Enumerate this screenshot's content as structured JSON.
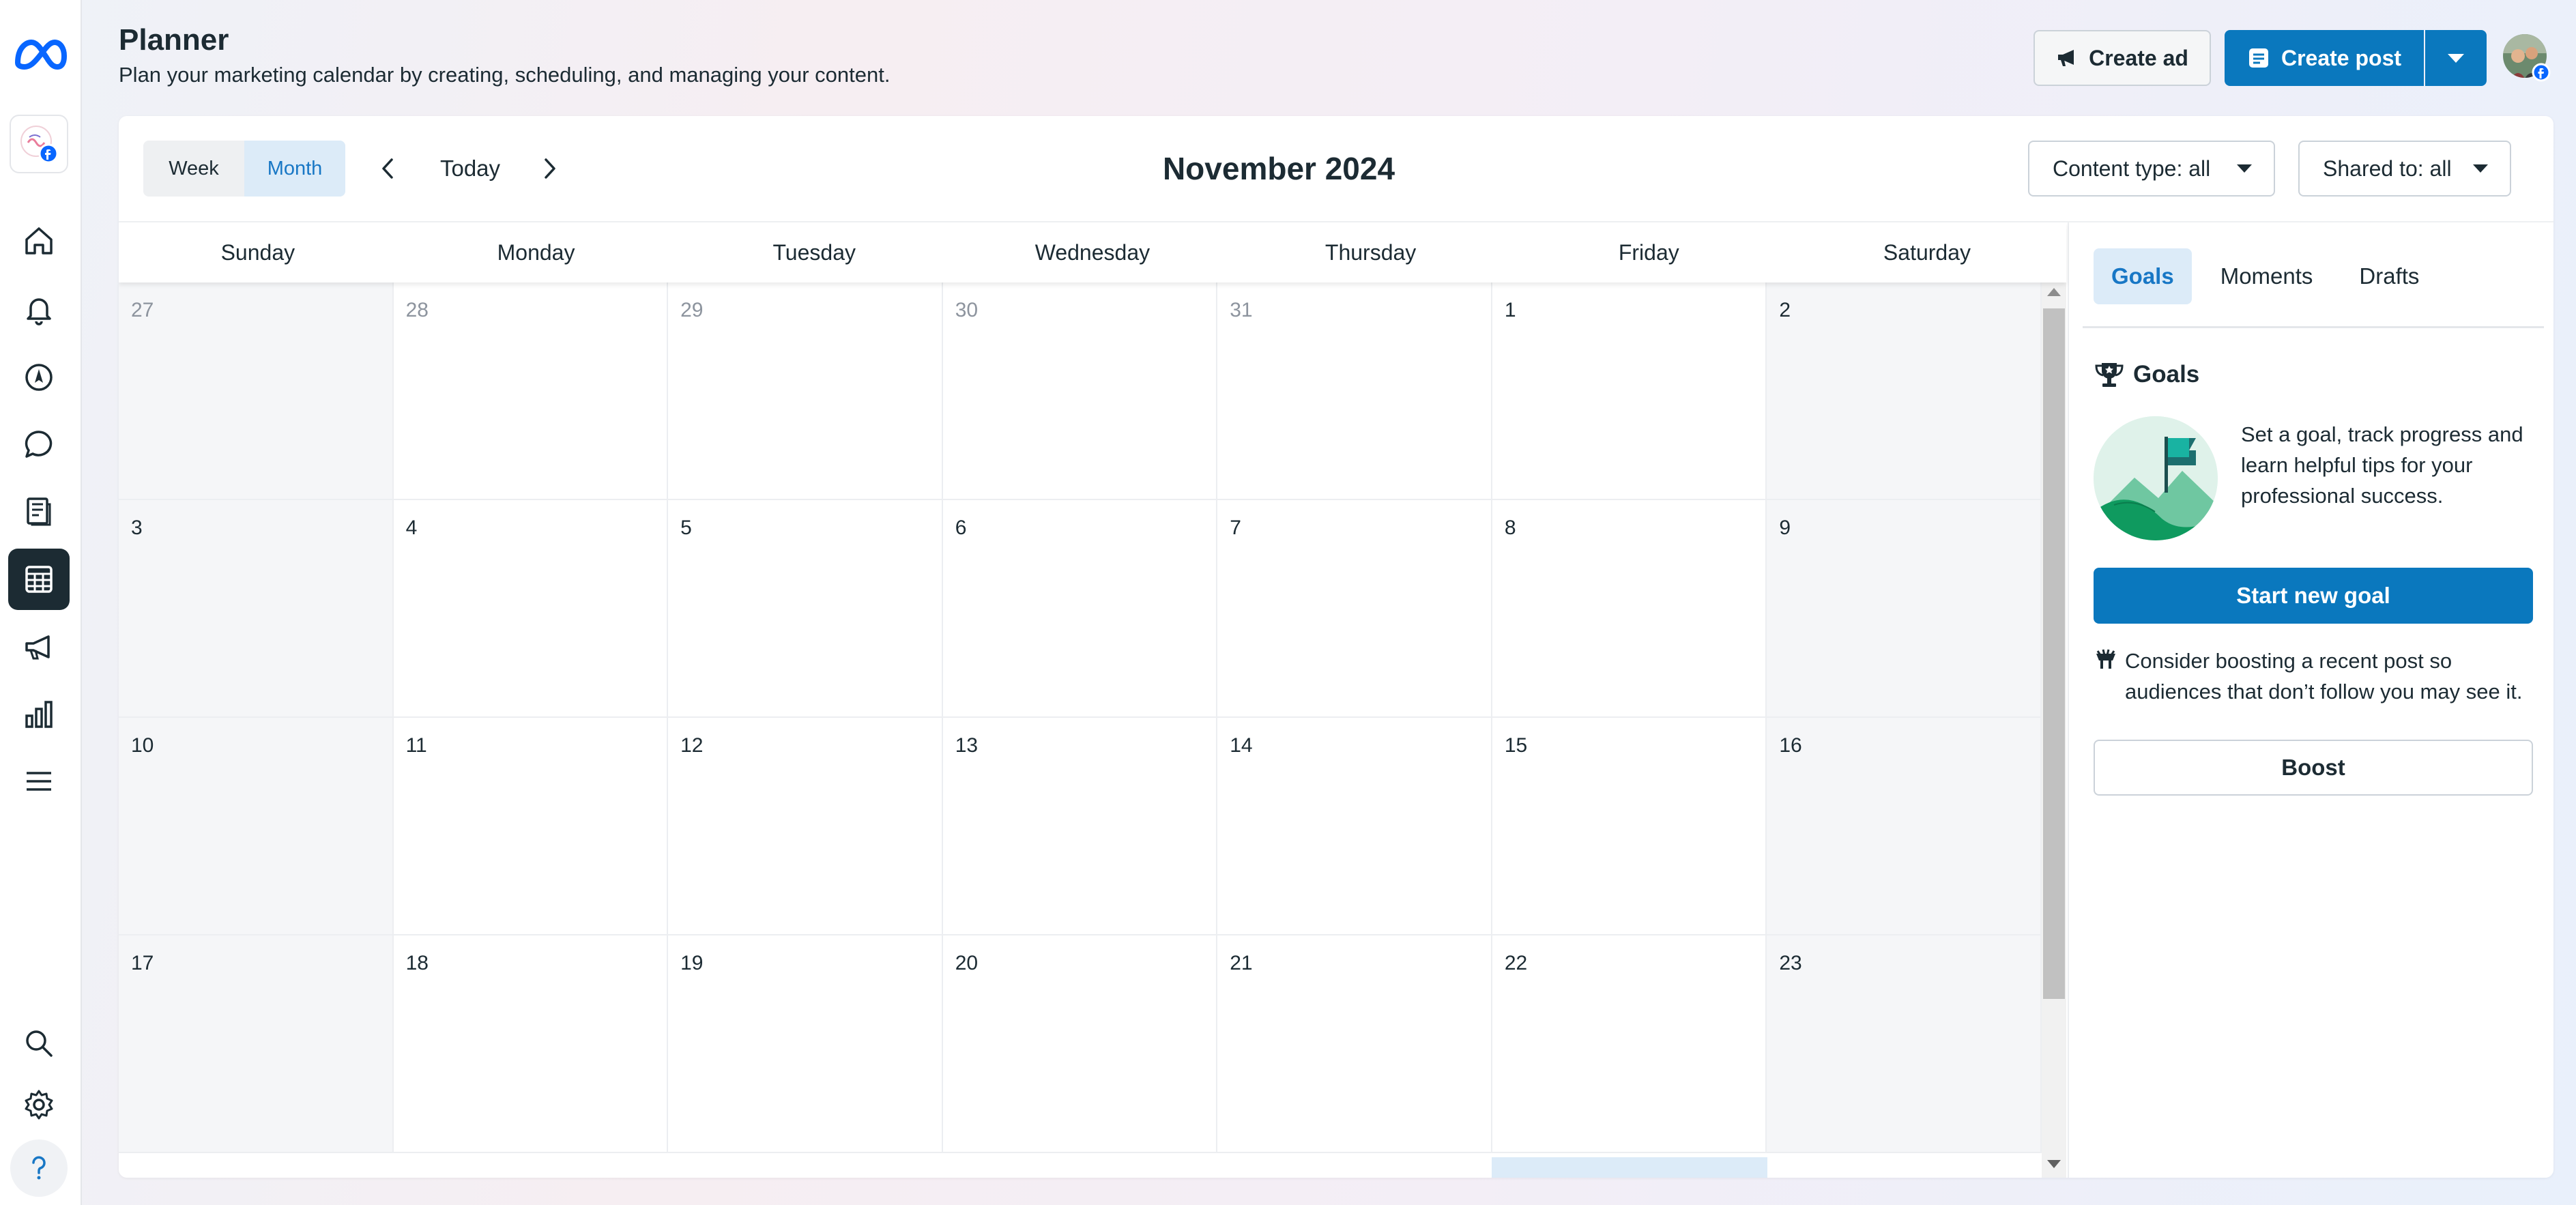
{
  "header": {
    "title": "Planner",
    "subtitle": "Plan your marketing calendar by creating, scheduling, and managing your content.",
    "create_ad_label": "Create ad",
    "create_post_label": "Create post"
  },
  "sidebar": {
    "items": [
      {
        "icon": "home-icon"
      },
      {
        "icon": "bell-icon"
      },
      {
        "icon": "compass-icon"
      },
      {
        "icon": "chat-icon"
      },
      {
        "icon": "content-pages-icon"
      },
      {
        "icon": "calendar-planner-icon",
        "active": true
      },
      {
        "icon": "megaphone-icon"
      },
      {
        "icon": "insights-bar-chart-icon"
      },
      {
        "icon": "menu-icon"
      }
    ],
    "bottom_items": [
      {
        "icon": "search-icon"
      },
      {
        "icon": "gear-icon"
      },
      {
        "icon": "help-icon"
      }
    ]
  },
  "toolbar": {
    "view_week": "Week",
    "view_month": "Month",
    "active_view": "Month",
    "today_label": "Today",
    "month_title": "November 2024",
    "content_type_label": "Content type: all",
    "shared_to_label": "Shared to: all"
  },
  "calendar": {
    "weekdays": [
      "Sunday",
      "Monday",
      "Tuesday",
      "Wednesday",
      "Thursday",
      "Friday",
      "Saturday"
    ],
    "weeks": [
      [
        "27",
        "28",
        "29",
        "30",
        "31",
        "1",
        "2"
      ],
      [
        "3",
        "4",
        "5",
        "6",
        "7",
        "8",
        "9"
      ],
      [
        "10",
        "11",
        "12",
        "13",
        "14",
        "15",
        "16"
      ],
      [
        "17",
        "18",
        "19",
        "20",
        "21",
        "22",
        "23"
      ]
    ]
  },
  "panel": {
    "tabs": [
      "Goals",
      "Moments",
      "Drafts"
    ],
    "active_tab": "Goals",
    "goals_heading": "Goals",
    "goals_description": "Set a goal, track progress and learn helpful tips for your professional success.",
    "start_goal_label": "Start new goal",
    "boost_tip": "Consider boosting a recent post so audiences that don’t follow you may see it.",
    "boost_label": "Boost"
  },
  "colors": {
    "primary": "#0a78be",
    "active_tab_bg": "#dcebf8",
    "active_tab_text": "#1877c5",
    "text": "#1c2b33",
    "muted_text": "#8d949e",
    "weekend_bg": "#f5f6f8"
  }
}
